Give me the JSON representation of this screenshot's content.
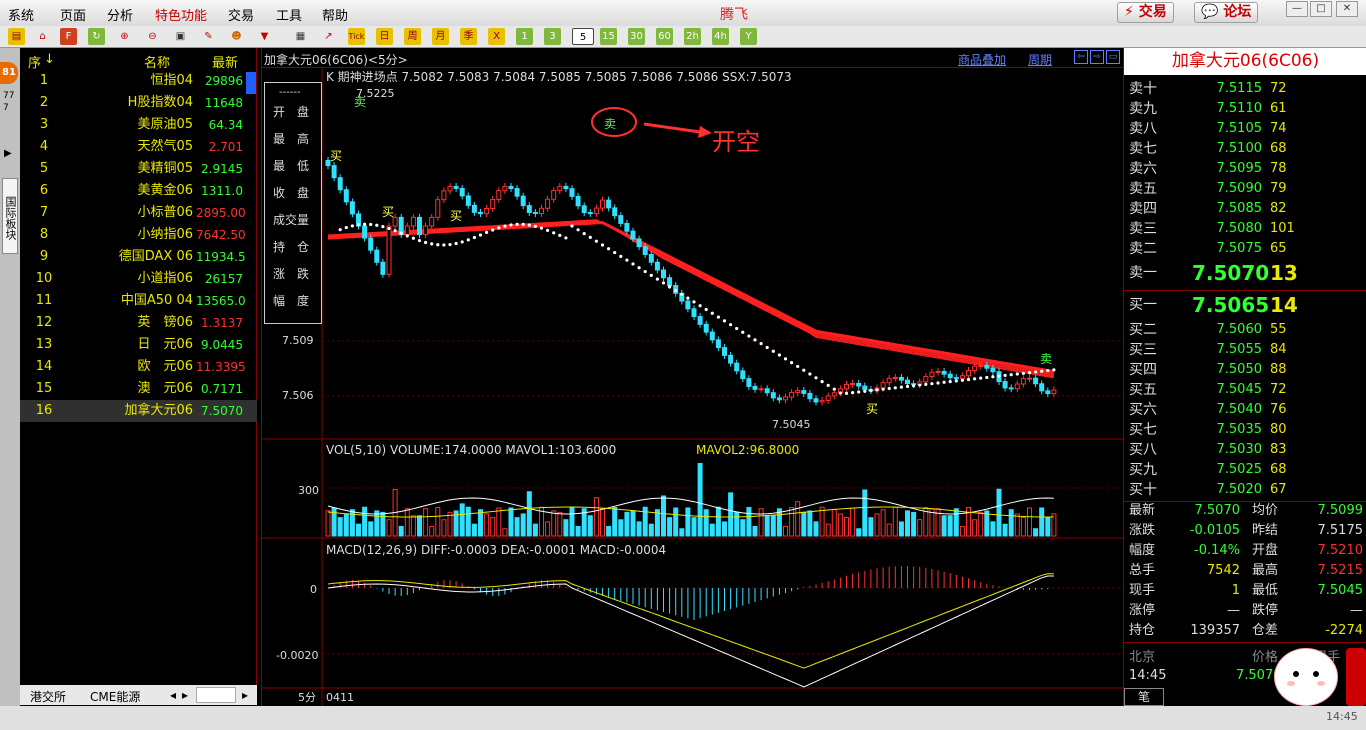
{
  "menu": {
    "items": [
      "系统",
      "页面",
      "分析",
      "特色功能",
      "交易",
      "工具",
      "帮助"
    ],
    "app_title": "腾飞",
    "trade_button": "交易",
    "forum_button": "论坛"
  },
  "toolbar": {
    "period_buttons": [
      "Tick",
      "日",
      "周",
      "月",
      "季",
      "X",
      "1",
      "3",
      "5",
      "15",
      "30",
      "60",
      "2h",
      "4h",
      "Y"
    ],
    "selected_period": "5"
  },
  "sidebar": {
    "badge": "81",
    "small_text": "77 7",
    "tab_label": "国际板块"
  },
  "quote_list": {
    "headers": {
      "idx": "序",
      "name": "名称",
      "price": "最新"
    },
    "rows": [
      {
        "idx": "1",
        "name": "恒指04",
        "price": "29896",
        "dir": "dn"
      },
      {
        "idx": "2",
        "name": "H股指数04",
        "price": "11648",
        "dir": "dn"
      },
      {
        "idx": "3",
        "name": "美原油05",
        "price": "64.34",
        "dir": "dn"
      },
      {
        "idx": "4",
        "name": "天然气05",
        "price": "2.701",
        "dir": "up"
      },
      {
        "idx": "5",
        "name": "美精铜05",
        "price": "2.9145",
        "dir": "dn"
      },
      {
        "idx": "6",
        "name": "美黄金06",
        "price": "1311.0",
        "dir": "dn"
      },
      {
        "idx": "7",
        "name": "小标普06",
        "price": "2895.00",
        "dir": "up"
      },
      {
        "idx": "8",
        "name": "小纳指06",
        "price": "7642.50",
        "dir": "up"
      },
      {
        "idx": "9",
        "name": "德国DAX 06",
        "price": "11934.5",
        "dir": "dn"
      },
      {
        "idx": "10",
        "name": "小道指06",
        "price": "26157",
        "dir": "dn"
      },
      {
        "idx": "11",
        "name": "中国A50 04",
        "price": "13565.0",
        "dir": "dn"
      },
      {
        "idx": "12",
        "name": "英　镑06",
        "price": "1.3137",
        "dir": "up"
      },
      {
        "idx": "13",
        "name": "日　元06",
        "price": "9.0445",
        "dir": "dn"
      },
      {
        "idx": "14",
        "name": "欧　元06",
        "price": "11.3395",
        "dir": "up"
      },
      {
        "idx": "15",
        "name": "澳　元06",
        "price": "0.7171",
        "dir": "dn"
      },
      {
        "idx": "16",
        "name": "加拿大元06",
        "price": "7.5070",
        "dir": "dn",
        "selected": true
      }
    ],
    "bottom_tabs": [
      "港交所",
      "CME能源"
    ]
  },
  "chart_header": {
    "title": "加拿大元06(6C06)<5分>",
    "overlay_link": "商品叠加",
    "period_link": "周期"
  },
  "kline": {
    "indicator_line": "K  期神进场点  7.5082  7.5083  7.5084  7.5085  7.5085  7.5086  7.5086  SSX:7.5073",
    "info_labels": [
      "开　盘",
      "最　高",
      "最　低",
      "收　盘",
      "成交量",
      "持　仓",
      "涨　跌",
      "幅　度"
    ],
    "info_top": "------",
    "y_ticks": [
      "7.509",
      "7.506"
    ],
    "high_label": "7.5225",
    "low_label": "7.5045",
    "annotation": "开空",
    "buy_label": "买",
    "sell_label": "卖"
  },
  "volume": {
    "indicator_line": "VOL(5,10)  VOLUME:174.0000  MAVOL1:103.6000",
    "mavol2": "MAVOL2:96.8000",
    "y_tick": "300"
  },
  "macd": {
    "indicator_line": "MACD(12,26,9)  DIFF:-0.0003  DEA:-0.0001  MACD:-0.0004",
    "y_ticks": [
      "0",
      "-0.0020"
    ]
  },
  "x_axis": {
    "period": "5分",
    "date": "0411"
  },
  "order_book": {
    "title": "加拿大元06(6C06)",
    "asks": [
      {
        "label": "卖十",
        "price": "7.5115",
        "vol": "72"
      },
      {
        "label": "卖九",
        "price": "7.5110",
        "vol": "61"
      },
      {
        "label": "卖八",
        "price": "7.5105",
        "vol": "74"
      },
      {
        "label": "卖七",
        "price": "7.5100",
        "vol": "68"
      },
      {
        "label": "卖六",
        "price": "7.5095",
        "vol": "78"
      },
      {
        "label": "卖五",
        "price": "7.5090",
        "vol": "79"
      },
      {
        "label": "卖四",
        "price": "7.5085",
        "vol": "82"
      },
      {
        "label": "卖三",
        "price": "7.5080",
        "vol": "101"
      },
      {
        "label": "卖二",
        "price": "7.5075",
        "vol": "65"
      },
      {
        "label": "卖一",
        "price": "7.5070",
        "vol": "13"
      }
    ],
    "bids": [
      {
        "label": "买一",
        "price": "7.5065",
        "vol": "14"
      },
      {
        "label": "买二",
        "price": "7.5060",
        "vol": "55"
      },
      {
        "label": "买三",
        "price": "7.5055",
        "vol": "84"
      },
      {
        "label": "买四",
        "price": "7.5050",
        "vol": "88"
      },
      {
        "label": "买五",
        "price": "7.5045",
        "vol": "72"
      },
      {
        "label": "买六",
        "price": "7.5040",
        "vol": "76"
      },
      {
        "label": "买七",
        "price": "7.5035",
        "vol": "80"
      },
      {
        "label": "买八",
        "price": "7.5030",
        "vol": "83"
      },
      {
        "label": "买九",
        "price": "7.5025",
        "vol": "68"
      },
      {
        "label": "买十",
        "price": "7.5020",
        "vol": "67"
      }
    ]
  },
  "stats": [
    {
      "l1": "最新",
      "v1": "7.5070",
      "c1": "dn",
      "l2": "均价",
      "v2": "7.5099",
      "c2": "dn"
    },
    {
      "l1": "涨跌",
      "v1": "-0.0105",
      "c1": "dn",
      "l2": "昨结",
      "v2": "7.5175",
      "c2": "wht"
    },
    {
      "l1": "幅度",
      "v1": "-0.14%",
      "c1": "dn",
      "l2": "开盘",
      "v2": "7.5210",
      "c2": "up"
    },
    {
      "l1": "总手",
      "v1": "7542",
      "c1": "yel",
      "l2": "最高",
      "v2": "7.5215",
      "c2": "up"
    },
    {
      "l1": "现手",
      "v1": "1",
      "c1": "yel",
      "l2": "最低",
      "v2": "7.5045",
      "c2": "dn"
    },
    {
      "l1": "涨停",
      "v1": "—",
      "c1": "wht",
      "l2": "跌停",
      "v2": "—",
      "c2": "wht"
    },
    {
      "l1": "持仓",
      "v1": "139357",
      "c1": "wht",
      "l2": "仓差",
      "v2": "-2274",
      "c2": "yel"
    }
  ],
  "ticks": {
    "headers": [
      "北京",
      "价格",
      "现手"
    ],
    "time": "14:45",
    "price": "7.5070",
    "tab": "笔"
  },
  "status": {
    "time": "14:45"
  }
}
